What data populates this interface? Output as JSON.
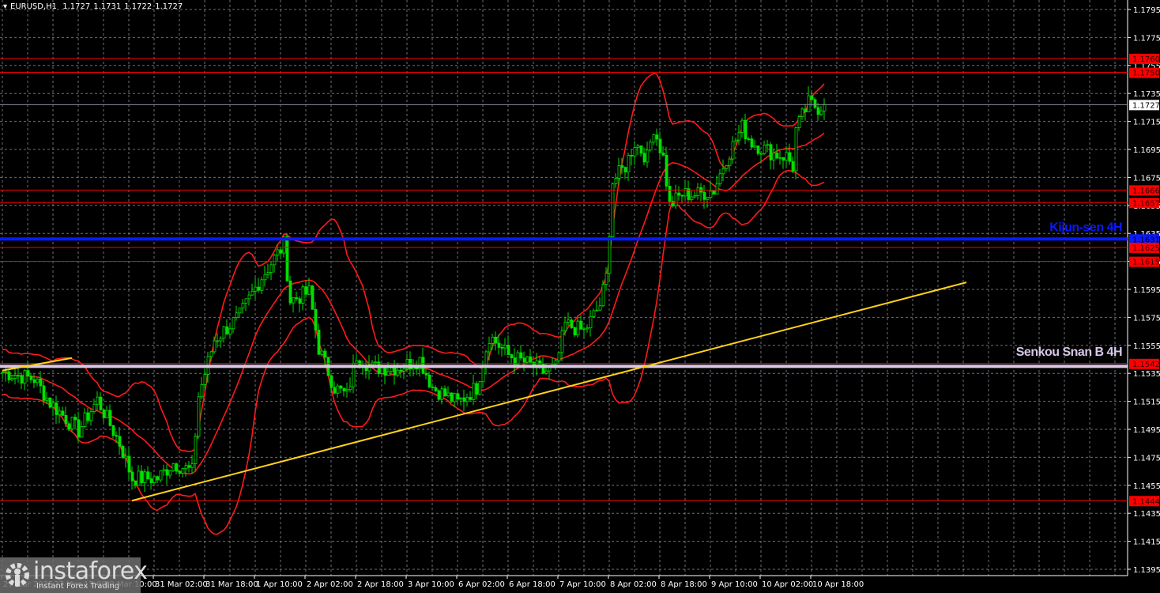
{
  "header": {
    "symbol": "EURUSD,H1",
    "open": "1.1727",
    "high": "1.1731",
    "low": "1.1722",
    "close": "1.1727"
  },
  "watermark": {
    "brand": "instaforex",
    "tagline": "Instant Forex Trading"
  },
  "colors": {
    "background": "#000000",
    "grid": "#8a8a9a",
    "candle": "#00e000",
    "bands": "#ff1a1a",
    "level": "#ff0000",
    "kijun": "#0a1aff",
    "senkou": "#d8c8e8",
    "trend": "#ffd21a",
    "axis": "#ffffff"
  },
  "chart_data": {
    "type": "candlestick",
    "title": "EURUSD,H1",
    "ylim": [
      1.1395,
      1.1795
    ],
    "y_ticks": [
      "1.1795",
      "1.1775",
      "1.1755",
      "1.1735",
      "1.1715",
      "1.1695",
      "1.1675",
      "1.1655",
      "1.1635",
      "1.1615",
      "1.1595",
      "1.1575",
      "1.1555",
      "1.1535",
      "1.1515",
      "1.1495",
      "1.1475",
      "1.1455",
      "1.1435",
      "1.1415",
      "1.1395"
    ],
    "x_labels": [
      "27 Mar 2025",
      "27 Mar 17:00",
      "30 Mar 10:00",
      "31 Mar 02:00",
      "31 Mar 18:00",
      "1 Apr 10:00",
      "2 Apr 02:00",
      "2 Apr 18:00",
      "3 Apr 10:00",
      "6 Apr 02:00",
      "6 Apr 18:00",
      "7 Apr 10:00",
      "8 Apr 02:00",
      "8 Apr 18:00",
      "9 Apr 10:00",
      "10 Apr 02:00",
      "10 Apr 18:00"
    ],
    "bars_per_label": 16,
    "price_path": [
      [
        0,
        1.1536
      ],
      [
        10,
        1.1531
      ],
      [
        15,
        1.1514
      ],
      [
        24,
        1.1494
      ],
      [
        30,
        1.1516
      ],
      [
        37,
        1.1485
      ],
      [
        41,
        1.146
      ],
      [
        49,
        1.146
      ],
      [
        54,
        1.1471
      ],
      [
        60,
        1.1465
      ],
      [
        62,
        1.1519
      ],
      [
        67,
        1.1559
      ],
      [
        75,
        1.1576
      ],
      [
        82,
        1.1604
      ],
      [
        89,
        1.1627
      ],
      [
        91,
        1.1587
      ],
      [
        97,
        1.1593
      ],
      [
        100,
        1.1553
      ],
      [
        105,
        1.1525
      ],
      [
        109,
        1.1519
      ],
      [
        112,
        1.1548
      ],
      [
        117,
        1.1539
      ],
      [
        125,
        1.1539
      ],
      [
        132,
        1.1545
      ],
      [
        136,
        1.1525
      ],
      [
        144,
        1.1514
      ],
      [
        150,
        1.1525
      ],
      [
        154,
        1.1562
      ],
      [
        160,
        1.1548
      ],
      [
        166,
        1.1542
      ],
      [
        171,
        1.1536
      ],
      [
        175,
        1.1539
      ],
      [
        178,
        1.157
      ],
      [
        184,
        1.1565
      ],
      [
        189,
        1.1584
      ],
      [
        191,
        1.1604
      ],
      [
        193,
        1.1672
      ],
      [
        197,
        1.1683
      ],
      [
        200,
        1.17
      ],
      [
        204,
        1.1689
      ],
      [
        206,
        1.1711
      ],
      [
        209,
        1.1689
      ],
      [
        211,
        1.1655
      ],
      [
        215,
        1.1663
      ],
      [
        220,
        1.1663
      ],
      [
        225,
        1.1666
      ],
      [
        229,
        1.1689
      ],
      [
        234,
        1.1711
      ],
      [
        237,
        1.17
      ],
      [
        244,
        1.1692
      ],
      [
        248,
        1.169
      ],
      [
        250,
        1.1683
      ],
      [
        251,
        1.1709
      ],
      [
        255,
        1.1728
      ],
      [
        258,
        1.1725
      ],
      [
        260,
        1.1727
      ]
    ],
    "indicators": {
      "bollinger": {
        "period": 20,
        "deviations": 2
      }
    },
    "levels": [
      {
        "price": 1.176,
        "label": "1.1760",
        "kind": "resistance"
      },
      {
        "price": 1.175,
        "label": "1.1750",
        "kind": "resistance"
      },
      {
        "price": 1.1727,
        "label": "1.1727",
        "kind": "current"
      },
      {
        "price": 1.1666,
        "label": "1.1666",
        "kind": "support"
      },
      {
        "price": 1.1657,
        "label": "1.1657",
        "kind": "support"
      },
      {
        "price": 1.1631,
        "label": "1.1631",
        "kind": "kijun"
      },
      {
        "price": 1.1625,
        "label": "1.1625",
        "kind": "support"
      },
      {
        "price": 1.1615,
        "label": "1.1615",
        "kind": "support"
      },
      {
        "price": 1.1542,
        "label": "1.1542",
        "kind": "support"
      },
      {
        "price": 1.154,
        "label": "",
        "kind": "senkou"
      },
      {
        "price": 1.1444,
        "label": "1.1444",
        "kind": "support"
      }
    ],
    "trendlines": [
      {
        "from": [
          41,
          1.1444
        ],
        "to": [
          305,
          1.16
        ]
      },
      {
        "from": [
          0,
          1.1537
        ],
        "to": [
          22,
          1.1546
        ]
      }
    ],
    "annotations": [
      {
        "text": "Kijun-sen 4H",
        "price": 1.1631
      },
      {
        "text": "Senkou Snan B 4H",
        "price": 1.1542
      }
    ]
  }
}
